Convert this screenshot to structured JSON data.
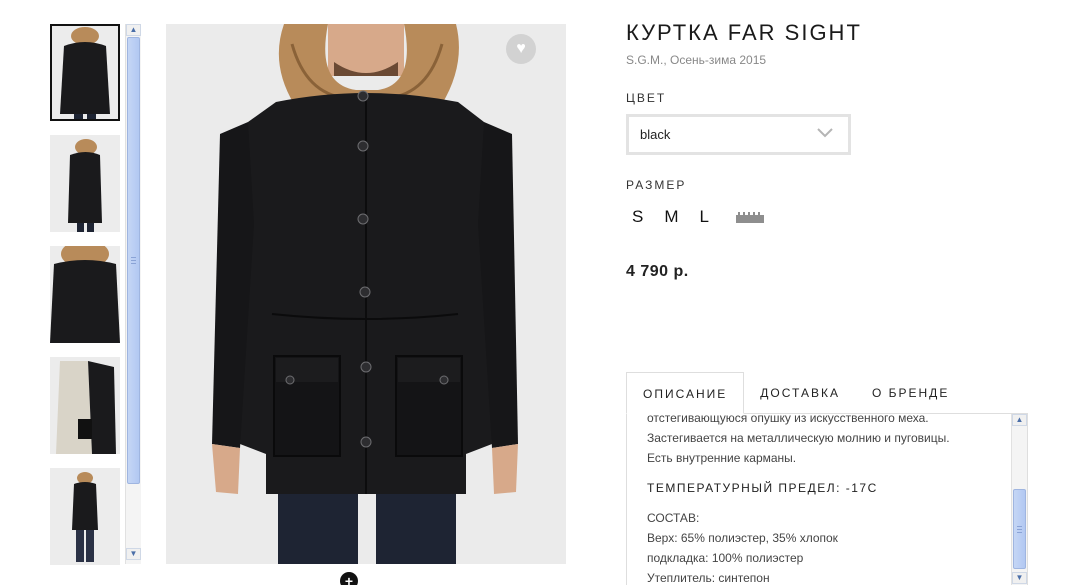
{
  "product": {
    "title": "КУРТКА FAR SIGHT",
    "subtitle": "S.G.M., Осень-зима 2015",
    "color_label": "ЦВЕТ",
    "color_value": "black",
    "size_label": "РАЗМЕР",
    "sizes": [
      "S",
      "M",
      "L"
    ],
    "price": "4 790 р."
  },
  "gallery": {
    "thumbnails": [
      "front",
      "side",
      "detail",
      "lining",
      "full"
    ],
    "active_index": 0
  },
  "tabs": [
    "ОПИСАНИЕ",
    "ДОСТАВКА",
    "О БРЕНДЕ"
  ],
  "description": {
    "line_cut": "отстегивающуюся опушку из искусственного меха.",
    "line1": "Застегивается на металлическую молнию и пуговицы.",
    "line2": "Есть внутренние карманы.",
    "temperature": "ТЕМПЕРАТУРНЫЙ ПРЕДЕЛ: -17С",
    "composition_title": "СОСТАВ:",
    "composition_1": "Верх: 65% полиэстер, 35% хлопок",
    "composition_2": "подкладка: 100% полиэстер",
    "composition_3": "Утеплитель: синтепон"
  },
  "icons": {
    "favorite": "heart-icon",
    "zoom": "plus-circle-icon",
    "dropdown": "chevron-down-icon",
    "size_chart": "ruler-icon"
  },
  "colors": {
    "jacket": "#1a1a1c",
    "fur": "#b88b5a",
    "scroll_thumb": "#b8cdf4"
  }
}
